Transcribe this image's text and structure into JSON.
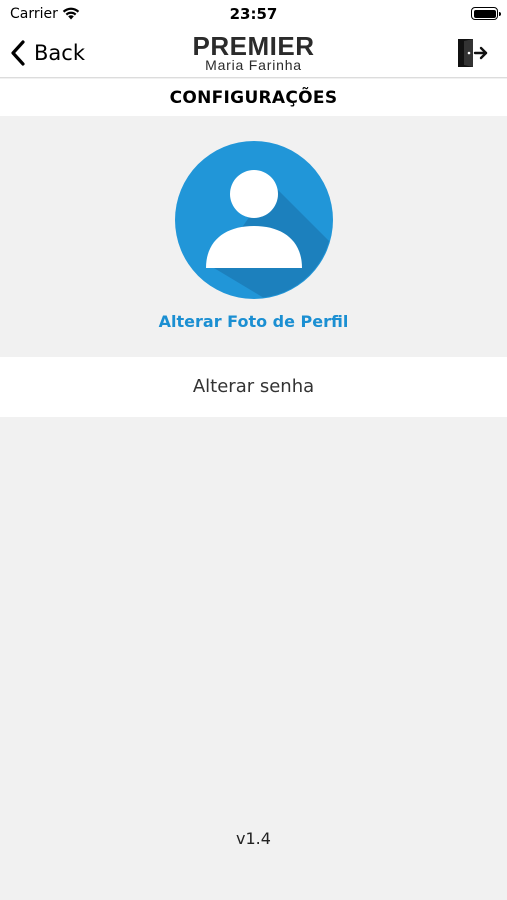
{
  "status_bar": {
    "carrier": "Carrier",
    "time": "23:57"
  },
  "nav": {
    "back_label": "Back",
    "logo_line1": "PREMIER",
    "logo_line2": "Maria Farinha"
  },
  "header": {
    "title": "CONFIGURAÇÕES"
  },
  "profile": {
    "change_photo_label": "Alterar Foto de Perfil"
  },
  "settings": {
    "change_password_label": "Alterar senha"
  },
  "footer": {
    "version": "v1.4"
  },
  "colors": {
    "accent": "#1b8fd2",
    "avatar_bg": "#2196d8",
    "avatar_shadow": "#1a6fa8",
    "background": "#f1f1f1"
  }
}
